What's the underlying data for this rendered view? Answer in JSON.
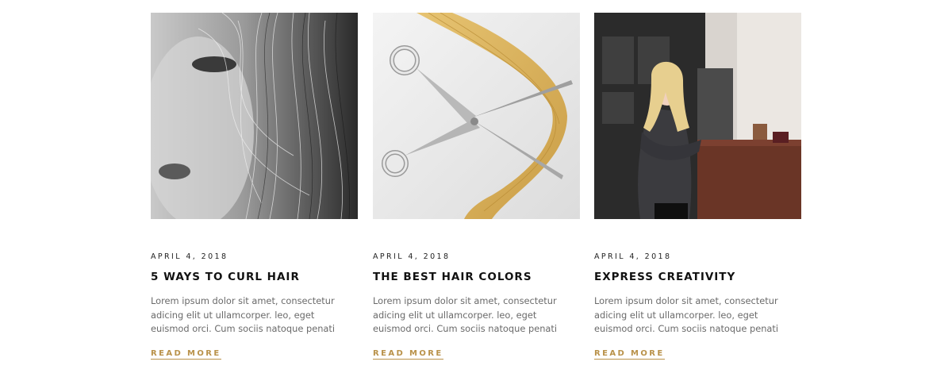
{
  "posts": [
    {
      "image_alt": "close-up black and white face with windswept hair",
      "date": "APRIL 4, 2018",
      "title": "5 WAYS TO CURL HAIR",
      "excerpt": "Lorem ipsum dolor sit amet, consectetur adicing elit ut ullamcorper. leo, eget euismod orci. Cum sociis natoque penati",
      "read_more": "READ MORE"
    },
    {
      "image_alt": "scissors cutting a lock of blonde hair",
      "date": "APRIL 4, 2018",
      "title": "THE BEST HAIR COLORS",
      "excerpt": "Lorem ipsum dolor sit amet, consectetur adicing elit ut ullamcorper. leo, eget euismod orci. Cum sociis natoque penati",
      "read_more": "READ MORE"
    },
    {
      "image_alt": "smiling blonde woman at salon reception desk",
      "date": "APRIL 4, 2018",
      "title": "EXPRESS CREATIVITY",
      "excerpt": "Lorem ipsum dolor sit amet, consectetur adicing elit ut ullamcorper. leo, eget euismod orci. Cum sociis natoque penati",
      "read_more": "READ MORE"
    }
  ],
  "colors": {
    "accent": "#b9924a",
    "title": "#111111",
    "text": "#6a6a6a"
  }
}
